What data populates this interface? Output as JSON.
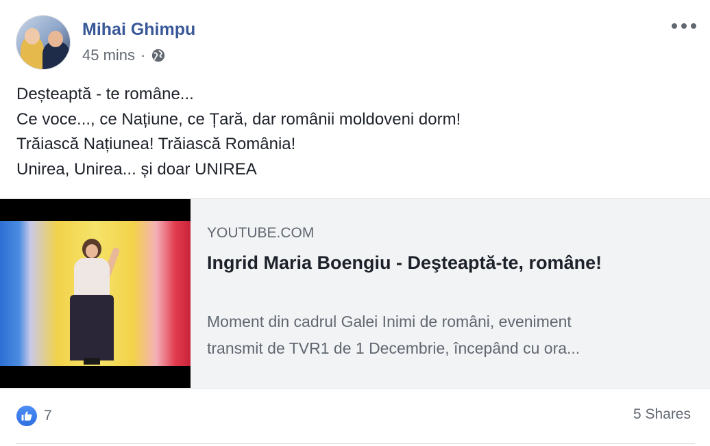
{
  "post": {
    "author": "Mihai Ghimpu",
    "time": "45 mins",
    "separator": "·",
    "privacy_icon": "globe-icon",
    "more_icon": "more-options-icon",
    "text_lines": [
      "Deșteaptă - te române...",
      "Ce voce..., ce Națiune, ce Țară, dar românii moldoveni dorm!",
      "Trăiască Națiunea! Trăiască România!",
      "Unirea, Unirea... și doar UNIREA"
    ]
  },
  "link_card": {
    "domain": "YOUTUBE.COM",
    "title": "Ingrid Maria Boengiu - Deşteaptă-te, române!",
    "description_lines": [
      "Moment din cadrul Galei Inimi de români, eveniment",
      "transmit de TVR1 de 1 Decembrie, începând cu ora..."
    ]
  },
  "footer": {
    "like_icon": "thumbs-up-icon",
    "like_count": "7",
    "shares": "5 Shares"
  },
  "colors": {
    "author_link": "#385898",
    "secondary_text": "#606770",
    "like_blue": "#2f6fe0",
    "card_bg": "#f2f3f5"
  }
}
